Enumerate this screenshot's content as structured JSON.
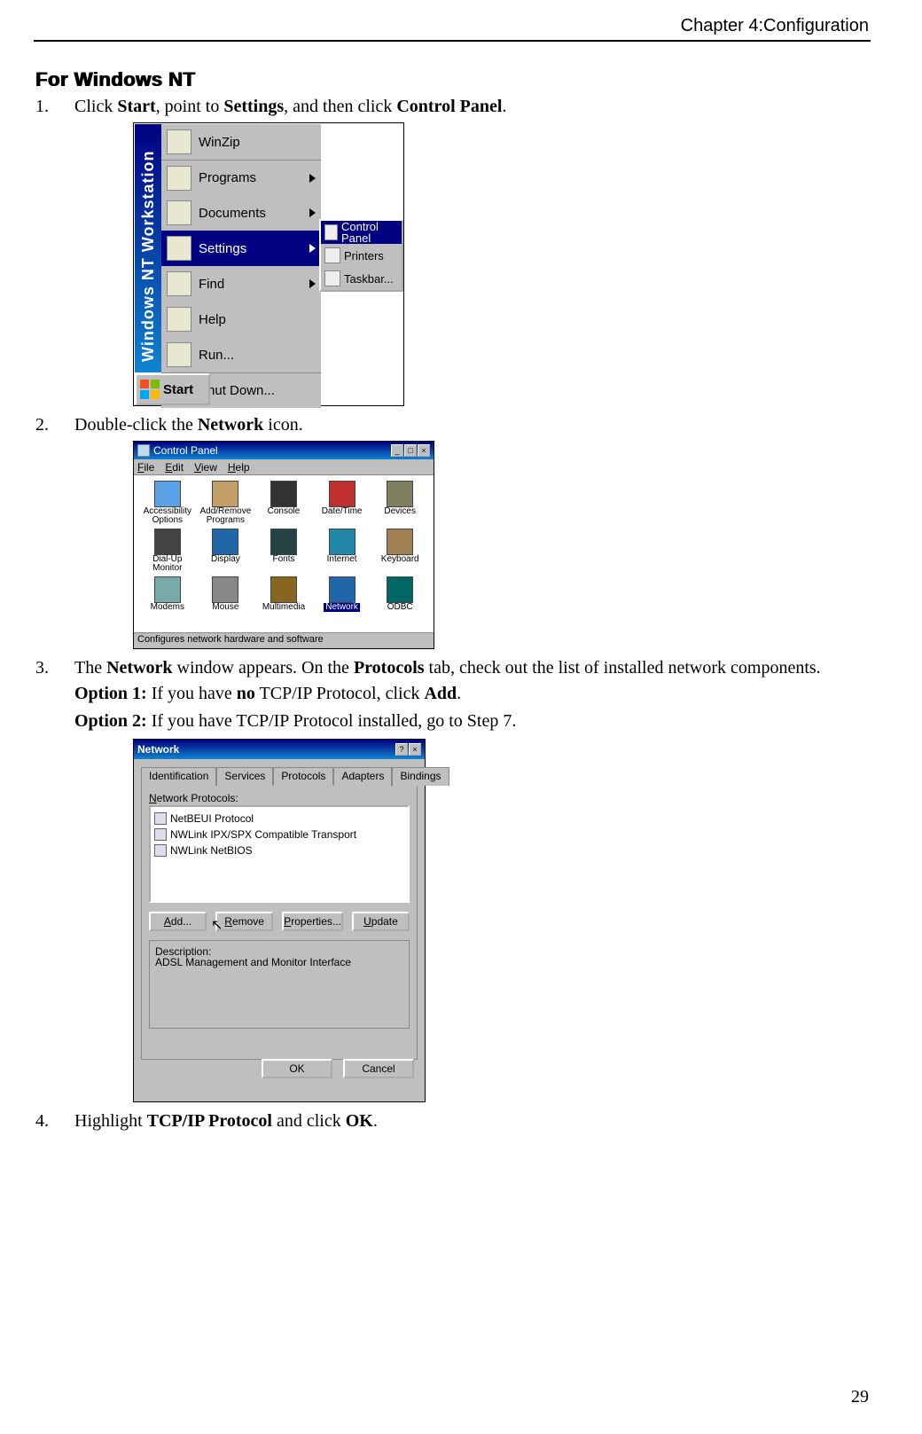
{
  "header": {
    "chapter": "Chapter 4:Configuration"
  },
  "section": {
    "title": "For Windows NT"
  },
  "steps": [
    {
      "num": "1.",
      "parts": [
        "Click ",
        "Start",
        ", point to ",
        "Settings",
        ", and then click ",
        "Control Panel",
        "."
      ]
    },
    {
      "num": "2.",
      "parts": [
        "Double-click the ",
        "Network",
        " icon."
      ]
    },
    {
      "num": "3.",
      "parts": [
        "The ",
        "Network",
        " window appears. On the ",
        "Protocols",
        " tab, check out the list of installed network components."
      ]
    },
    {
      "num": "4.",
      "parts": [
        "Highlight ",
        "TCP/IP Protocol",
        " and click ",
        "OK",
        "."
      ]
    }
  ],
  "options": {
    "opt1_label": "Option 1:",
    "opt1_parts": [
      " If you have ",
      "no",
      " TCP/IP Protocol, click ",
      "Add",
      "."
    ],
    "opt2_label": "Option 2:",
    "opt2_text": " If you have TCP/IP Protocol installed, go to Step 7."
  },
  "startmenu": {
    "sidebar": "Windows NT Workstation",
    "items": [
      {
        "label": "WinZip",
        "arrow": false
      },
      {
        "label": "Programs",
        "arrow": true
      },
      {
        "label": "Documents",
        "arrow": true
      },
      {
        "label": "Settings",
        "arrow": true,
        "selected": true
      },
      {
        "label": "Find",
        "arrow": true
      },
      {
        "label": "Help",
        "arrow": false
      },
      {
        "label": "Run...",
        "arrow": false
      },
      {
        "label": "Shut Down...",
        "arrow": false
      }
    ],
    "submenu": [
      {
        "label": "Control Panel",
        "selected": true
      },
      {
        "label": "Printers",
        "selected": false
      },
      {
        "label": "Taskbar...",
        "selected": false
      }
    ],
    "start_label": "Start"
  },
  "control_panel": {
    "title": "Control Panel",
    "menus": [
      "File",
      "Edit",
      "View",
      "Help"
    ],
    "icons": [
      {
        "label": "Accessibility Options",
        "color": "#5aa0e6"
      },
      {
        "label": "Add/Remove Programs",
        "color": "#c4a068"
      },
      {
        "label": "Console",
        "color": "#333"
      },
      {
        "label": "Date/Time",
        "color": "#c03030"
      },
      {
        "label": "Devices",
        "color": "#808060"
      },
      {
        "label": "Dial-Up Monitor",
        "color": "#444"
      },
      {
        "label": "Display",
        "color": "#26a"
      },
      {
        "label": "Fonts",
        "color": "#244"
      },
      {
        "label": "Internet",
        "color": "#28a"
      },
      {
        "label": "Keyboard",
        "color": "#a08050"
      },
      {
        "label": "Modems",
        "color": "#7aa"
      },
      {
        "label": "Mouse",
        "color": "#888"
      },
      {
        "label": "Multimedia",
        "color": "#862"
      },
      {
        "label": "Network",
        "color": "#26a",
        "selected": true
      },
      {
        "label": "ODBC",
        "color": "#066"
      }
    ],
    "status": "Configures network hardware and software"
  },
  "network": {
    "title": "Network",
    "tabs": [
      "Identification",
      "Services",
      "Protocols",
      "Adapters",
      "Bindings"
    ],
    "active_tab": 2,
    "group_label": "Network Protocols:",
    "protocols": [
      "NetBEUI Protocol",
      "NWLink IPX/SPX Compatible Transport",
      "NWLink NetBIOS"
    ],
    "buttons": [
      "Add...",
      "Remove",
      "Properties...",
      "Update"
    ],
    "desc_label": "Description:",
    "desc_text": "ADSL Management and Monitor Interface",
    "ok": "OK",
    "cancel": "Cancel"
  },
  "page_number": "29"
}
